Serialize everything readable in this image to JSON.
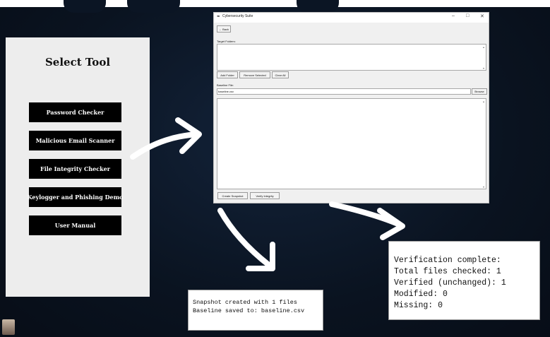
{
  "tool_panel": {
    "title": "Select Tool",
    "buttons": [
      "Password Checker",
      "Malicious Email Scanner",
      "File Integrity Checker",
      "Keylogger and Phishing Demo",
      "User Manual"
    ]
  },
  "window": {
    "title": "Cybersecurity Suite",
    "back_label": "← Back",
    "target_folders_label": "Target Folders:",
    "add_folder_label": "Add Folder",
    "remove_selected_label": "Remove Selected",
    "clear_all_label": "Clear All",
    "baseline_file_label": "Baseline File:",
    "baseline_value": "baseline.csv",
    "browse_label": "Browse",
    "create_snapshot_label": "Create Snapshot",
    "verify_integrity_label": "Verify Integrity"
  },
  "snapshot_output": {
    "lines": [
      "Snapshot created with 1 files",
      "Baseline saved to: baseline.csv"
    ]
  },
  "verification_output": {
    "lines": [
      "Verification complete:",
      "Total files checked: 1",
      "Verified (unchanged): 1",
      "Modified: 0",
      "Missing: 0"
    ]
  },
  "colors": {
    "background": "#0b1524",
    "panel": "#ededed",
    "tool_button": "#000000",
    "arrow": "#ffffff"
  }
}
